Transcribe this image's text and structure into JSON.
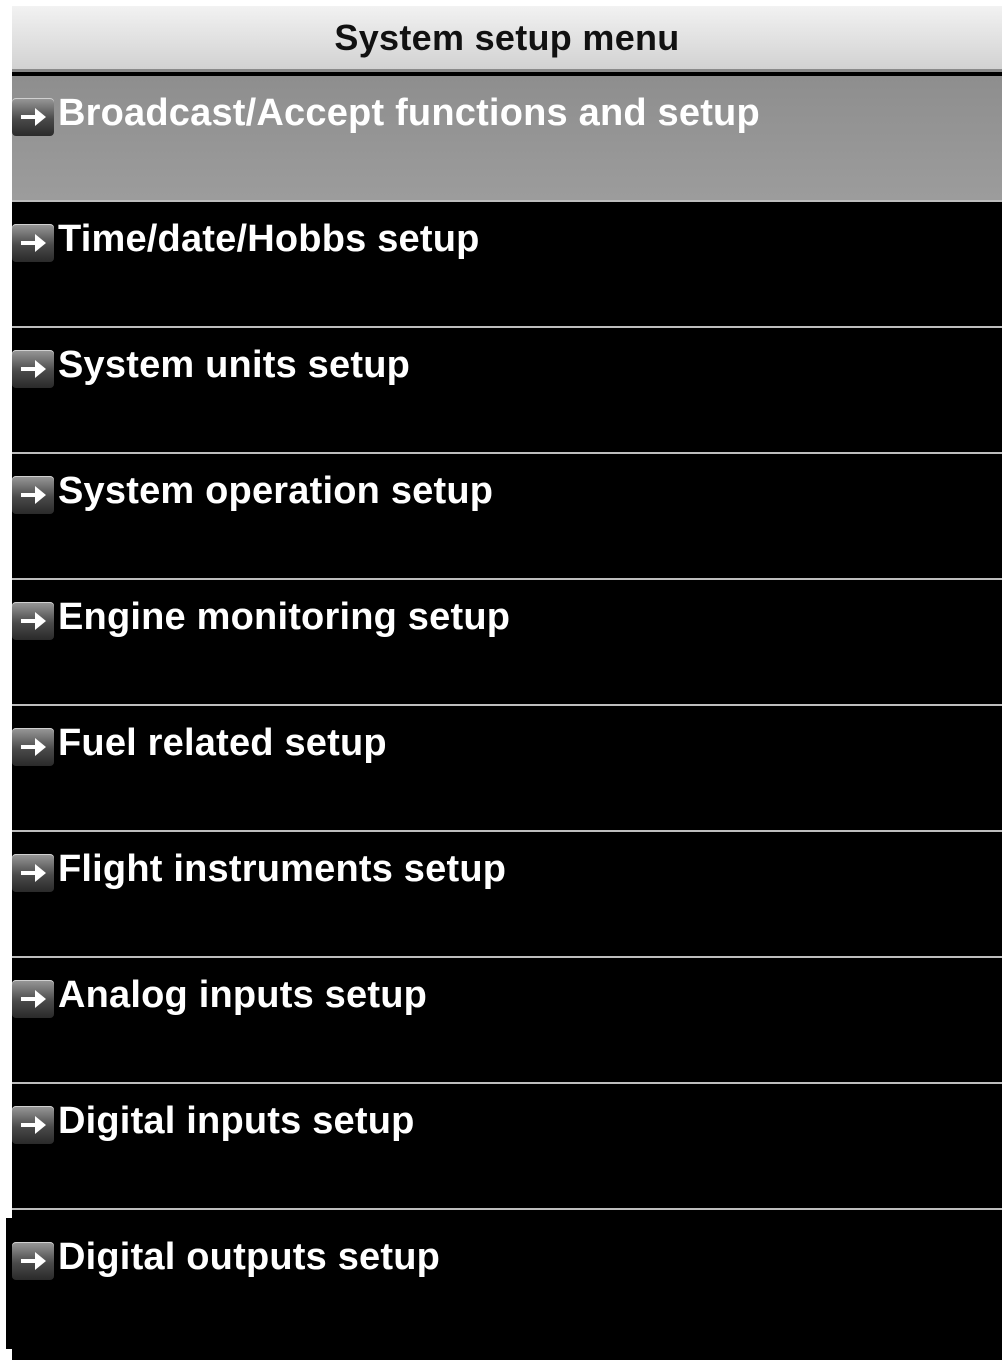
{
  "header": {
    "title": "System setup menu"
  },
  "menu": {
    "items": [
      {
        "label": "Broadcast/Accept functions and setup",
        "icon": "arrow-right-icon",
        "selected": true
      },
      {
        "label": "Time/date/Hobbs setup",
        "icon": "arrow-right-icon",
        "selected": false
      },
      {
        "label": "System units setup",
        "icon": "arrow-right-icon",
        "selected": false
      },
      {
        "label": "System operation setup",
        "icon": "arrow-right-icon",
        "selected": false
      },
      {
        "label": "Engine monitoring setup",
        "icon": "arrow-right-icon",
        "selected": false
      },
      {
        "label": "Fuel related setup",
        "icon": "arrow-right-icon",
        "selected": false
      },
      {
        "label": "Flight instruments setup",
        "icon": "arrow-right-icon",
        "selected": false
      },
      {
        "label": "Analog inputs setup",
        "icon": "arrow-right-icon",
        "selected": false
      },
      {
        "label": "Digital inputs setup",
        "icon": "arrow-right-icon",
        "selected": false
      },
      {
        "label": "Digital outputs setup",
        "icon": "arrow-right-icon",
        "selected": false
      }
    ]
  },
  "colors": {
    "background": "#000000",
    "text": "#ffffff",
    "selected_row": "#959595",
    "title_bar": "#dcdcdc",
    "title_text": "#111111",
    "separator": "#bdbdbd"
  }
}
